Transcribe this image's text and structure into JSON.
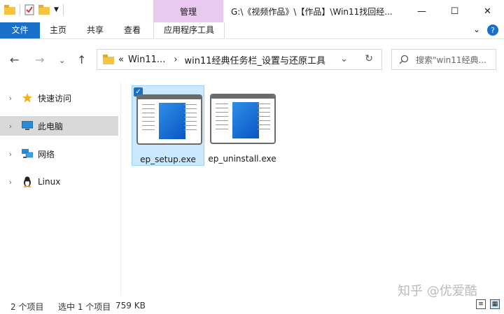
{
  "titlebar": {
    "context_tab": "管理",
    "path": "G:\\《视频作品》\\【作品】\\Win11找回经...",
    "minimize": "—",
    "maximize": "☐",
    "close": "✕"
  },
  "ribbon": {
    "tabs": [
      "文件",
      "主页",
      "共享",
      "查看",
      "应用程序工具"
    ],
    "collapse": "⌄",
    "help": "?"
  },
  "nav": {
    "back": "←",
    "forward": "→",
    "recent": "⌄",
    "up": "↑",
    "address_prefix": "«",
    "address_parts": [
      "Win11...",
      "win11经典任务栏_设置与还原工具"
    ],
    "separator": "›",
    "refresh": "↻",
    "search_placeholder": "搜索\"win11经典..."
  },
  "sidebar": {
    "items": [
      {
        "label": "快速访问",
        "icon": "star-icon"
      },
      {
        "label": "此电脑",
        "icon": "computer-icon",
        "selected": true
      },
      {
        "label": "网络",
        "icon": "network-icon"
      },
      {
        "label": "Linux",
        "icon": "linux-icon"
      }
    ]
  },
  "files": [
    {
      "name": "ep_setup.exe",
      "selected": true
    },
    {
      "name": "ep_uninstall.exe",
      "selected": false
    }
  ],
  "status": {
    "count": "2 个项目",
    "selection": "选中 1 个项目",
    "size": "759 KB"
  },
  "watermark": "知乎 @优爱酷",
  "colors": {
    "accent": "#1a6fc9",
    "manage_tab": "#e9c9ef",
    "selection": "#cce8ff"
  }
}
